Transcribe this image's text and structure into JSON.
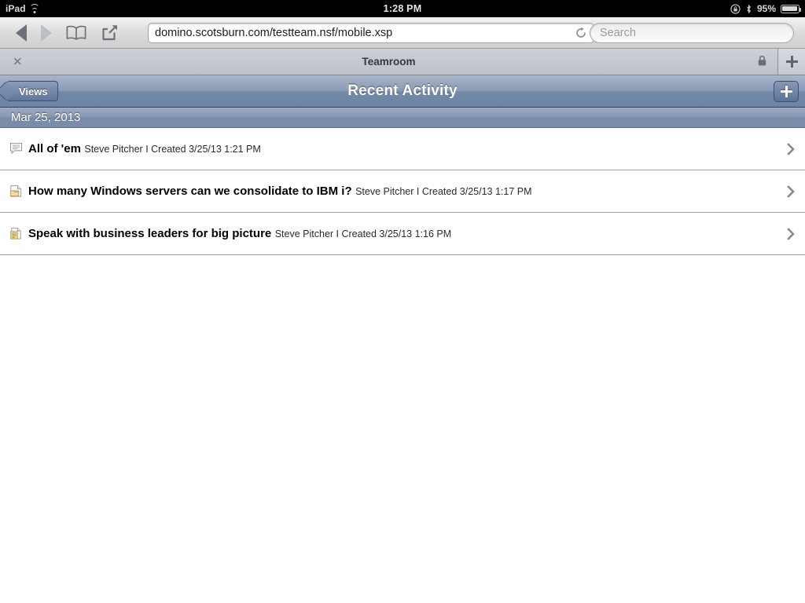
{
  "status_bar": {
    "carrier": "iPad",
    "wifi_icon": "wifi-icon",
    "time": "1:28 PM",
    "rotation_lock_icon": "rotation-lock-icon",
    "bluetooth_icon": "bluetooth-icon",
    "battery_percent": "95%",
    "battery_icon": "battery-icon"
  },
  "browser_toolbar": {
    "back_icon": "back-arrow-icon",
    "forward_icon": "forward-arrow-icon",
    "bookmarks_icon": "bookmarks-book-icon",
    "share_icon": "share-icon",
    "url": "domino.scotsburn.com/testteam.nsf/mobile.xsp",
    "url_placeholder": "",
    "reload_icon": "reload-icon",
    "search_value": "",
    "search_placeholder": "Search"
  },
  "tab_bar": {
    "close_icon": "close-icon",
    "tab_title": "Teamroom",
    "lock_icon": "lock-icon",
    "new_tab_icon": "plus-icon"
  },
  "app_header": {
    "back_label": "Views",
    "title": "Recent Activity",
    "add_icon": "plus-icon",
    "accent_color": "#6d84a4",
    "title_color": "#ffffff"
  },
  "content": {
    "date_header": "Mar 25, 2013",
    "items": [
      {
        "icon": "comment-bubble-icon",
        "title": "All of 'em",
        "subtitle": "Steve Pitcher I Created 3/25/13 1:21 PM",
        "chevron": "chevron-right-icon"
      },
      {
        "icon": "document-folder-icon",
        "title": "How many Windows servers can we consolidate to IBM i?",
        "subtitle": "Steve Pitcher I Created 3/25/13 1:17 PM",
        "chevron": "chevron-right-icon"
      },
      {
        "icon": "document-lines-icon",
        "title": "Speak with business leaders for big picture",
        "subtitle": "Steve Pitcher I Created 3/25/13 1:16 PM",
        "chevron": "chevron-right-icon"
      }
    ]
  }
}
